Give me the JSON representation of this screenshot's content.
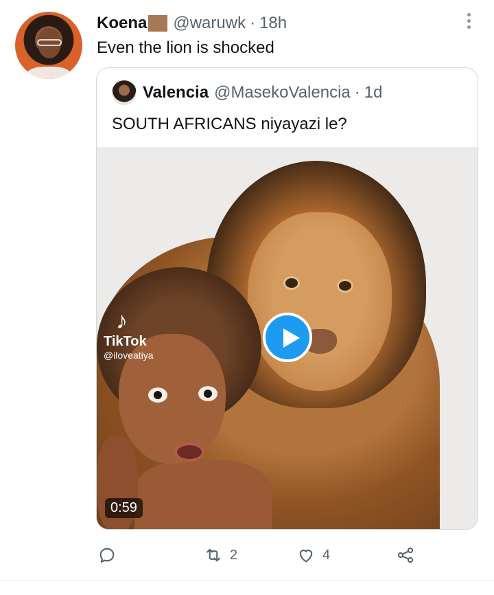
{
  "tweet": {
    "author_name": "Koena",
    "author_name_glyph": "🏽",
    "handle": "@waruwk",
    "separator": "·",
    "time": "18h",
    "text": "Even the lion is shocked"
  },
  "quoted": {
    "author_name": "Valencia",
    "handle": "@MasekoValencia",
    "separator": "·",
    "time": "1d",
    "text": "SOUTH AFRICANS niyayazi le?"
  },
  "media": {
    "watermark_brand": "TikTok",
    "watermark_user": "@iloveatiya",
    "duration": "0:59"
  },
  "actions": {
    "reply_icon": "reply-icon",
    "retweet_icon": "retweet-icon",
    "retweet_count": "2",
    "like_icon": "heart-icon",
    "like_count": "4",
    "share_icon": "share-icon"
  },
  "colors": {
    "accent": "#1d9bf0",
    "text_secondary": "#536471",
    "border": "#cfd9de"
  }
}
